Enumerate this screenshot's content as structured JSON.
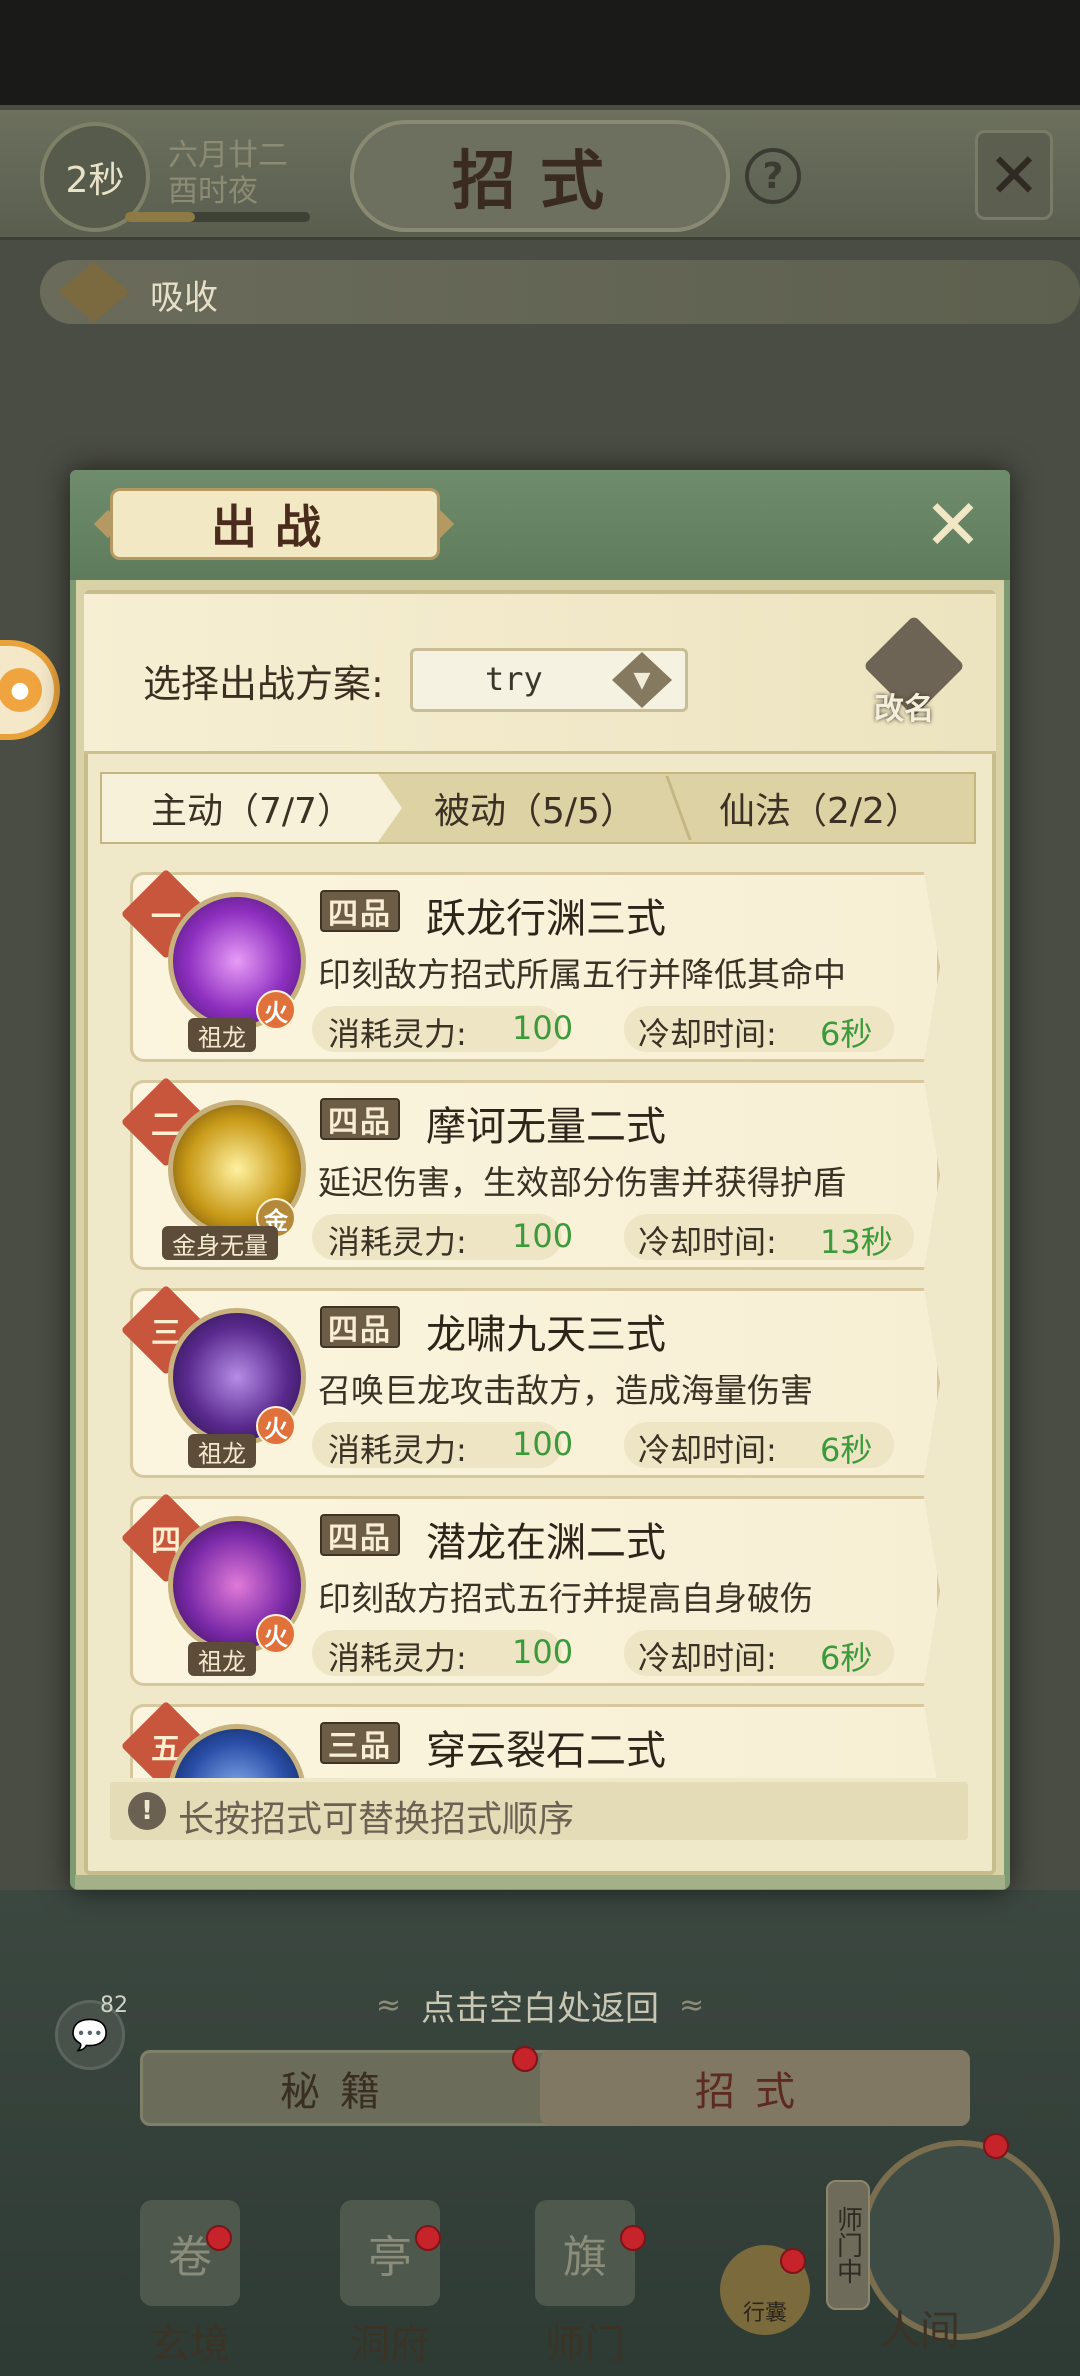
{
  "header": {
    "timer": "2秒",
    "date_line1": "六月廿二",
    "date_line2": "酉时夜",
    "progress": 0.38,
    "title": "招式",
    "help_label": "?",
    "close_glyph": "✕"
  },
  "absorb": {
    "label": "吸收"
  },
  "modal": {
    "title": "出战",
    "close_glyph": "✕",
    "plan_label": "选择出战方案:",
    "plan_value": "try",
    "rename_label": "改名",
    "tabs": [
      {
        "label": "主动（7/7）",
        "active": true
      },
      {
        "label": "被动（5/5）",
        "active": false
      },
      {
        "label": "仙法（2/2）",
        "active": false
      }
    ],
    "stat_cost_label": "消耗灵力:",
    "stat_cd_label": "冷却时间:",
    "skills": [
      {
        "rank": "一",
        "grade": "四品",
        "name": "跃龙行渊三式",
        "desc": "印刻敌方招式所属五行并降低其命中",
        "cost": "100",
        "cooldown": "6秒",
        "element": "火",
        "tag": "祖龙",
        "icon_color": "#8e2fc0"
      },
      {
        "rank": "二",
        "grade": "四品",
        "name": "摩诃无量二式",
        "desc": "延迟伤害，生效部分伤害并获得护盾",
        "cost": "100",
        "cooldown": "13秒",
        "element": "金",
        "tag": "金身无量",
        "icon_color": "#c89a18"
      },
      {
        "rank": "三",
        "grade": "四品",
        "name": "龙啸九天三式",
        "desc": "召唤巨龙攻击敌方，造成海量伤害",
        "cost": "100",
        "cooldown": "6秒",
        "element": "火",
        "tag": "祖龙",
        "icon_color": "#5a2a8e"
      },
      {
        "rank": "四",
        "grade": "四品",
        "name": "潜龙在渊二式",
        "desc": "印刻敌方招式五行并提高自身破伤",
        "cost": "100",
        "cooldown": "6秒",
        "element": "火",
        "tag": "祖龙",
        "icon_color": "#7b2aa8"
      },
      {
        "rank": "五",
        "grade": "三品",
        "name": "穿云裂石二式",
        "desc": "",
        "cost": "",
        "cooldown": "",
        "element": "",
        "tag": "",
        "icon_color": "#2a4fa8"
      }
    ],
    "footer_note": "长按招式可替换招式顺序",
    "note_icon": "!"
  },
  "back_hint": "点击空白处返回",
  "chat": {
    "count": "82",
    "icon": "💬"
  },
  "bottom_tabs": {
    "secret": "秘籍",
    "moves": "招式"
  },
  "nav": {
    "items": [
      {
        "label": "玄境",
        "glyph": "卷"
      },
      {
        "label": "洞府",
        "glyph": "亭"
      },
      {
        "label": "师门",
        "glyph": "旗"
      }
    ],
    "bag_label": "行囊",
    "world_label": "人间",
    "world_badge": "师门中"
  },
  "colors": {
    "accent_green": "#3c9a3a",
    "rank_red": "#c8563c",
    "fire": "#e0713a",
    "metal": "#b48a3a"
  }
}
